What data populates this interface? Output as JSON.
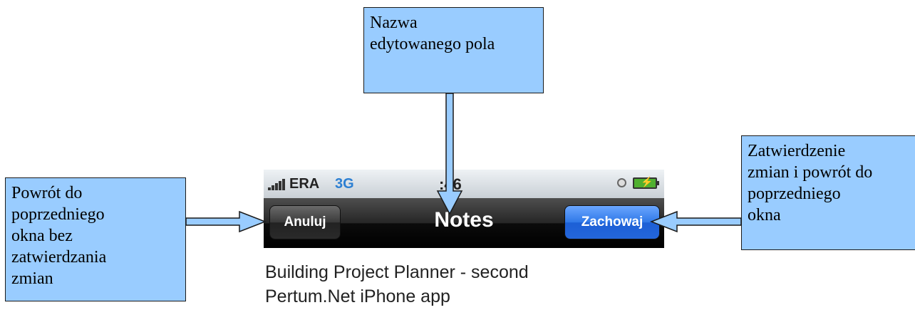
{
  "callouts": {
    "field_name": "Nazwa\nedytowanego pola",
    "cancel": "Powrót do\npoprzedniego\nokna  bez\nzatwierdzania\nzmian",
    "save": "Zatwierdzenie\nzmian i powrót do\npoprzedniego\nokna"
  },
  "phone": {
    "status_bar": {
      "carrier": "ERA",
      "network": "3G",
      "time": ":46"
    },
    "nav_bar": {
      "cancel_label": "Anuluj",
      "title": "Notes",
      "save_label": "Zachowaj"
    },
    "note_text": "Building Project Planner - second\nPertum.Net iPhone app"
  },
  "colors": {
    "callout_fill": "#99ccff",
    "save_button": "#2f78e8"
  }
}
